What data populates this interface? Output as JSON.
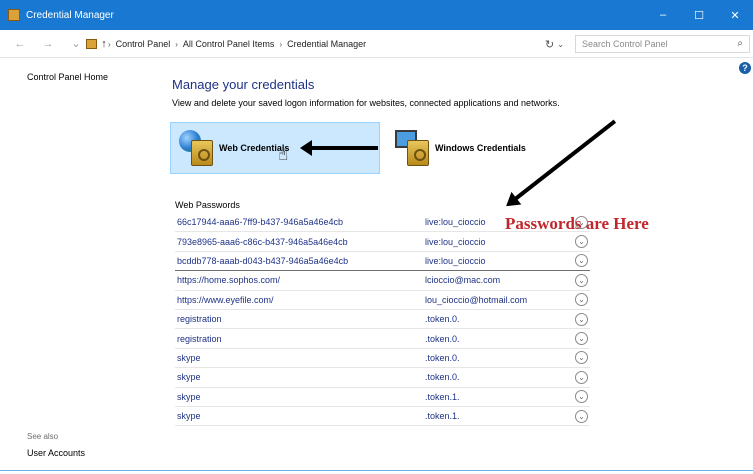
{
  "window": {
    "title": "Credential Manager",
    "minimize": "–",
    "maximize": "☐",
    "close": "✕"
  },
  "address_bar": {
    "back": "←",
    "forward": "→",
    "recent": "⌄",
    "up": "↑",
    "breadcrumb": [
      "Control Panel",
      "All Control Panel Items",
      "Credential Manager"
    ],
    "separator": "›",
    "dropdown": "⌄",
    "refresh": "↻",
    "search_placeholder": "Search Control Panel",
    "search_icon": "⌕"
  },
  "help_icon": "?",
  "sidebar": {
    "home": "Control Panel Home",
    "see_also": "See also",
    "user_accounts": "User Accounts"
  },
  "main": {
    "title": "Manage your credentials",
    "description": "View and delete your saved logon information for websites, connected applications and networks.",
    "tiles": {
      "web": "Web Credentials",
      "windows": "Windows Credentials"
    },
    "section_title": "Web Passwords",
    "annotation": "Passwords are Here",
    "expand_glyph": "⌄",
    "rows": [
      {
        "address": "66c17944-aaa6-7ff9-b437-946a5a46e4cb",
        "user": "live:lou_cioccio"
      },
      {
        "address": "793e8965-aaa6-c86c-b437-946a5a46e4cb",
        "user": "live:lou_cioccio"
      },
      {
        "address": "bcddb778-aaab-d043-b437-946a5a46e4cb",
        "user": "live:lou_cioccio"
      },
      {
        "address": "https://home.sophos.com/",
        "user": "lcioccio@mac.com"
      },
      {
        "address": "https://www.eyefile.com/",
        "user": "lou_cioccio@hotmail.com"
      },
      {
        "address": "registration",
        "user": ".token.0."
      },
      {
        "address": "registration",
        "user": ".token.0."
      },
      {
        "address": "skype",
        "user": ".token.0."
      },
      {
        "address": "skype",
        "user": ".token.0."
      },
      {
        "address": "skype",
        "user": ".token.1."
      },
      {
        "address": "skype",
        "user": ".token.1."
      }
    ]
  },
  "colors": {
    "titlebar": "#1979d2",
    "link": "#1e3287",
    "selection": "#cce8ff",
    "annotation": "#c0272d"
  }
}
